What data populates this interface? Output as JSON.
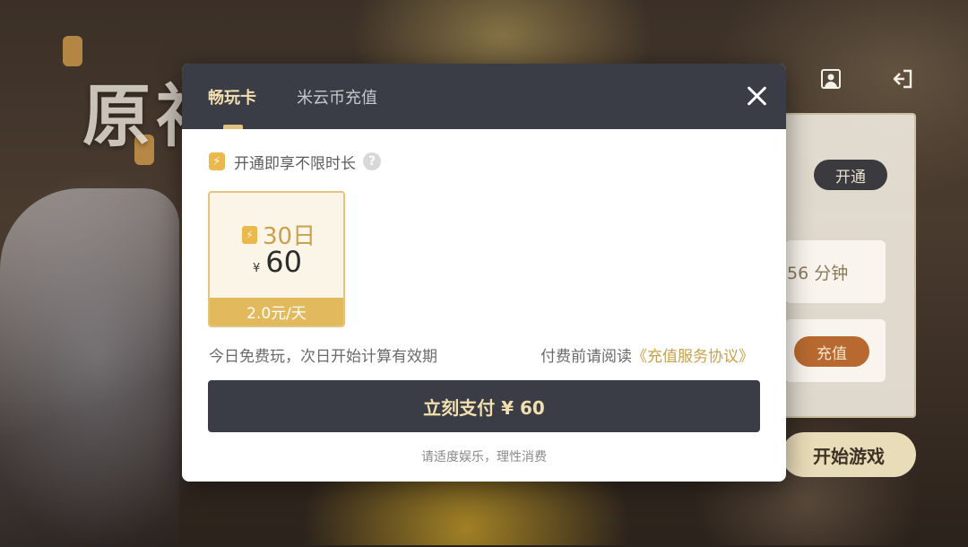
{
  "background": {
    "logo_text": "原神",
    "panel": {
      "open_label": "开通",
      "time_text": "56 分钟",
      "recharge_label": "充值",
      "start_game_label": "开始游戏"
    },
    "icons": [
      "user-icon",
      "exit-icon"
    ]
  },
  "modal": {
    "tabs": [
      {
        "label": "畅玩卡",
        "active": true
      },
      {
        "label": "米云币充值",
        "active": false
      }
    ],
    "info_text": "开通即享不限时长",
    "plan": {
      "days": "30日",
      "currency": "¥",
      "price": "60",
      "daily": "2.0元/天",
      "selected": true
    },
    "note_left": "今日免费玩，次日开始计算有效期",
    "note_right_prefix": "付费前请阅读",
    "agreement_link": "《充值服务协议》",
    "pay_button": "立刻支付 ¥ 60",
    "footer_note": "请适度娱乐，理性消费"
  },
  "colors": {
    "header_bg": "#3b3d46",
    "accent_gold": "#e2ba5d",
    "tab_active": "#f2dfb0",
    "link": "#c9a14c"
  }
}
